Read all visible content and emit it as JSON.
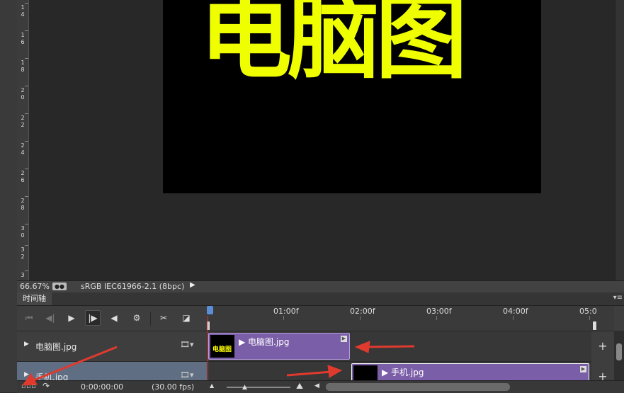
{
  "ruler_labels": [
    [
      "1",
      "4"
    ],
    [
      "1",
      "6"
    ],
    [
      "1",
      "8"
    ],
    [
      "2",
      "0"
    ],
    [
      "2",
      "2"
    ],
    [
      "2",
      "4"
    ],
    [
      "2",
      "6"
    ],
    [
      "2",
      "8"
    ],
    [
      "3",
      "0"
    ],
    [
      "3",
      "2"
    ],
    [
      "3",
      ""
    ]
  ],
  "document": {
    "text": "电脑图",
    "text_color": "#f0ff00",
    "background": "#000000"
  },
  "statusbar": {
    "zoom": "66.67%",
    "profile": "sRGB IEC61966-2.1 (8bpc)",
    "menu_arrow": "▶"
  },
  "timeline": {
    "tab": "时间轴",
    "menu": "▾≡",
    "ruler": [
      "01:00f",
      "02:00f",
      "03:00f",
      "04:00f",
      "05:0"
    ],
    "controls": {
      "first": "⏮",
      "prev": "◀|",
      "play": "▶",
      "next": "|▶",
      "audio": "◀",
      "settings": "⚙",
      "cut": "✂",
      "transition": "◪"
    },
    "tracks": [
      {
        "name": "电脑图.jpg",
        "clip_label": "电脑图.jpg",
        "thumb_caption": "电脑图",
        "film": "🎞▾",
        "add": "+"
      },
      {
        "name": "手机.jpg",
        "clip_label": "手机.jpg",
        "thumb_caption": "",
        "film": "🎞▾",
        "add": "+"
      }
    ],
    "footer": {
      "render_icon": "▫▫▫",
      "share": "↷",
      "time": "0:00:00:00",
      "fps": "(30.00 fps)",
      "zoom_min": "▲",
      "zoom_knob": "▲",
      "zoom_max": "⛰",
      "scroll_left": "◀"
    }
  },
  "colors": {
    "clip": "#7b5ea8",
    "arrow": "#e03a2f",
    "playhead": "#5a8fd8"
  }
}
